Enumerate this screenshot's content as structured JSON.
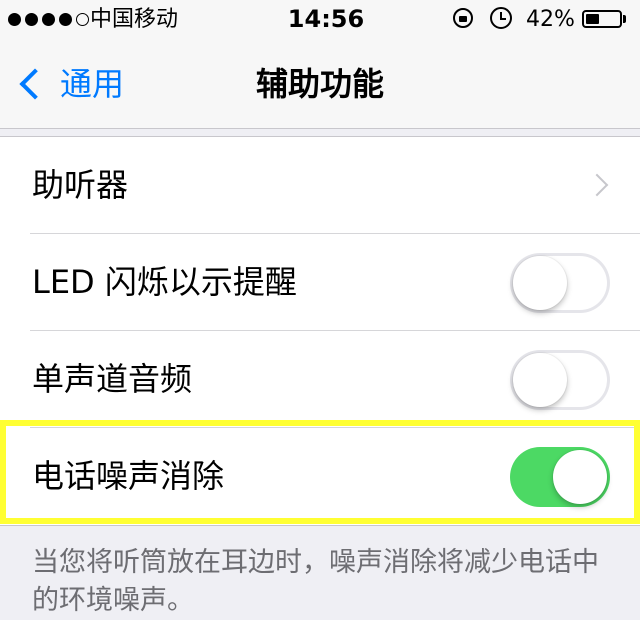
{
  "status_bar": {
    "signal_dots": [
      true,
      true,
      true,
      true,
      false
    ],
    "carrier": "中国移动",
    "time": "14:56",
    "battery_percent": "42%",
    "battery_level": 0.42,
    "icons": [
      "rotation-lock-icon",
      "alarm-icon",
      "battery-icon"
    ]
  },
  "nav": {
    "back_label": "通用",
    "title": "辅助功能"
  },
  "settings": [
    {
      "label": "助听器",
      "type": "disclosure"
    },
    {
      "label": "LED 闪烁以示提醒",
      "type": "toggle",
      "on": false
    },
    {
      "label": "单声道音频",
      "type": "toggle",
      "on": false
    },
    {
      "label": "电话噪声消除",
      "type": "toggle",
      "on": true,
      "highlighted": true
    }
  ],
  "footer_note": "当您将听筒放在耳边时，噪声消除将减少电话中的环境噪声。",
  "colors": {
    "accent": "#007aff",
    "toggle_on": "#4cd964",
    "highlight": "#ffff33",
    "background": "#efeff4"
  }
}
